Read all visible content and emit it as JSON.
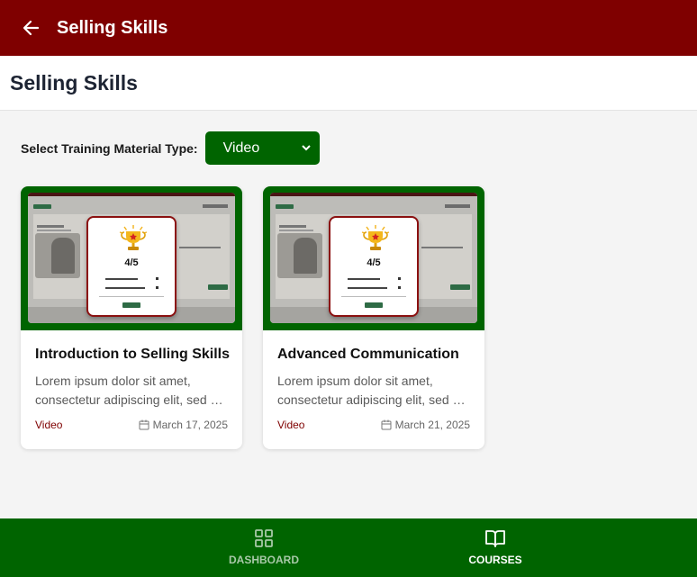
{
  "topbar": {
    "title": "Selling Skills",
    "back_icon": "arrow-left-icon"
  },
  "page": {
    "title": "Selling Skills"
  },
  "filter": {
    "label": "Select Training Material Type:",
    "selected": "Video"
  },
  "cards": [
    {
      "title": "Introduction to Selling Skills",
      "description": "Lorem ipsum dolor sit amet, consectetur adipiscing elit, sed do eiusmod tempor incididunt ut labore et dolore magna aliqua.",
      "type": "Video",
      "date": "March 17, 2025",
      "thumbnail": {
        "score": "4/5"
      }
    },
    {
      "title": "Advanced Communication",
      "description": "Lorem ipsum dolor sit amet, consectetur adipiscing elit, sed do eiusmod tempor incididunt ut labore et dolore magna aliqua.",
      "type": "Video",
      "date": "March 21, 2025",
      "thumbnail": {
        "score": "4/5"
      }
    }
  ],
  "bottom_nav": {
    "items": [
      {
        "label": "DASHBOARD",
        "icon": "grid-icon",
        "active": false
      },
      {
        "label": "COURSES",
        "icon": "book-open-icon",
        "active": true
      }
    ]
  },
  "colors": {
    "header": "#7f0000",
    "accent_green": "#006400",
    "type_text": "#7f0000"
  }
}
